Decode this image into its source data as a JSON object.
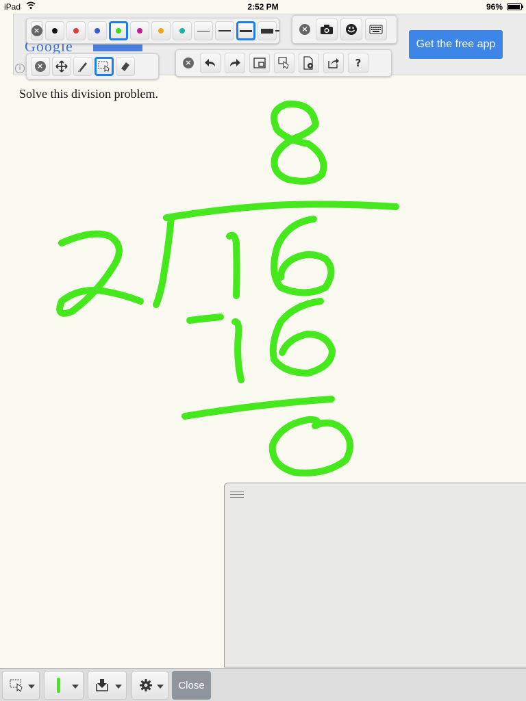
{
  "status_bar": {
    "device": "iPad",
    "time": "2:52 PM",
    "battery": "96%",
    "battery_level": 0.96
  },
  "ad": {
    "logo_text": "Google",
    "info_glyph": "i",
    "button_label": "Get the free app"
  },
  "toolbar_colors": {
    "close_glyph": "×",
    "colors": [
      {
        "name": "black",
        "hex": "#111111"
      },
      {
        "name": "red",
        "hex": "#e53935"
      },
      {
        "name": "blue",
        "hex": "#2f5fe0"
      },
      {
        "name": "green",
        "hex": "#3ddc16"
      },
      {
        "name": "magenta",
        "hex": "#c2189c"
      },
      {
        "name": "orange",
        "hex": "#f2a612"
      },
      {
        "name": "teal",
        "hex": "#17b5a6"
      }
    ],
    "selected_color": "green",
    "line_widths": [
      "thin",
      "medium",
      "thick",
      "extra-thick"
    ],
    "selected_width": "thick"
  },
  "toolbar_tools": {
    "close_glyph": "×",
    "tools": [
      "move-icon",
      "pen-icon",
      "select-icon",
      "eraser-icon"
    ],
    "selected_tool": "select-icon"
  },
  "toolbar_media": {
    "close_glyph": "×",
    "items": [
      "camera-icon",
      "smiley-icon",
      "keyboard-icon"
    ]
  },
  "toolbar_actions": {
    "close_glyph": "×",
    "items": [
      "undo-icon",
      "redo-icon",
      "resize-window-icon",
      "touch-select-icon",
      "page-settings-icon",
      "share-icon",
      "help-icon"
    ],
    "help_glyph": "?"
  },
  "prompt": "Solve this division problem.",
  "ink_color": "#44e81c",
  "bottom_bar": {
    "items": [
      "select-icon",
      "pen-color-icon",
      "import-icon",
      "settings-icon"
    ],
    "close_label": "Close"
  }
}
